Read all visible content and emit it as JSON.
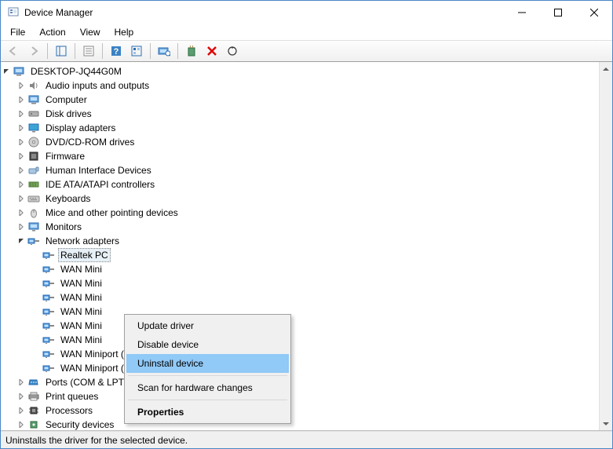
{
  "window": {
    "title": "Device Manager"
  },
  "menubar": {
    "file": "File",
    "action": "Action",
    "view": "View",
    "help": "Help"
  },
  "toolbar": {
    "back": "Back",
    "forward": "Forward",
    "show_hide_console": "Show/Hide Console Tree",
    "properties": "Properties",
    "help": "Help",
    "show_hidden": "Show hidden devices",
    "scan": "Scan for hardware changes",
    "add_legacy": "Add legacy hardware",
    "uninstall": "Uninstall device",
    "update": "Update device driver"
  },
  "tree": {
    "root": "DESKTOP-JQ44G0M",
    "categories": [
      {
        "name": "Audio inputs and outputs",
        "icon": "audio"
      },
      {
        "name": "Computer",
        "icon": "computer"
      },
      {
        "name": "Disk drives",
        "icon": "disk"
      },
      {
        "name": "Display adapters",
        "icon": "display"
      },
      {
        "name": "DVD/CD-ROM drives",
        "icon": "dvd"
      },
      {
        "name": "Firmware",
        "icon": "firmware"
      },
      {
        "name": "Human Interface Devices",
        "icon": "hid"
      },
      {
        "name": "IDE ATA/ATAPI controllers",
        "icon": "ide"
      },
      {
        "name": "Keyboards",
        "icon": "keyboard"
      },
      {
        "name": "Mice and other pointing devices",
        "icon": "mouse"
      },
      {
        "name": "Monitors",
        "icon": "monitor"
      },
      {
        "name": "Network adapters",
        "icon": "net",
        "expanded": true,
        "children": [
          {
            "name": "Realtek PC",
            "icon": "net",
            "selected": true,
            "truncated": true
          },
          {
            "name": "WAN Mini",
            "icon": "net",
            "truncated": true
          },
          {
            "name": "WAN Mini",
            "icon": "net",
            "truncated": true
          },
          {
            "name": "WAN Mini",
            "icon": "net",
            "truncated": true
          },
          {
            "name": "WAN Mini",
            "icon": "net",
            "truncated": true
          },
          {
            "name": "WAN Mini",
            "icon": "net",
            "truncated": true
          },
          {
            "name": "WAN Mini",
            "icon": "net",
            "truncated": true
          },
          {
            "name": "WAN Miniport (PPTP)",
            "icon": "net"
          },
          {
            "name": "WAN Miniport (SSTP)",
            "icon": "net"
          }
        ]
      },
      {
        "name": "Ports (COM & LPT)",
        "icon": "port"
      },
      {
        "name": "Print queues",
        "icon": "printer"
      },
      {
        "name": "Processors",
        "icon": "cpu"
      },
      {
        "name": "Security devices",
        "icon": "security"
      }
    ]
  },
  "context_menu": {
    "update": "Update driver",
    "disable": "Disable device",
    "uninstall": "Uninstall device",
    "scan": "Scan for hardware changes",
    "properties": "Properties"
  },
  "statusbar": {
    "text": "Uninstalls the driver for the selected device."
  }
}
